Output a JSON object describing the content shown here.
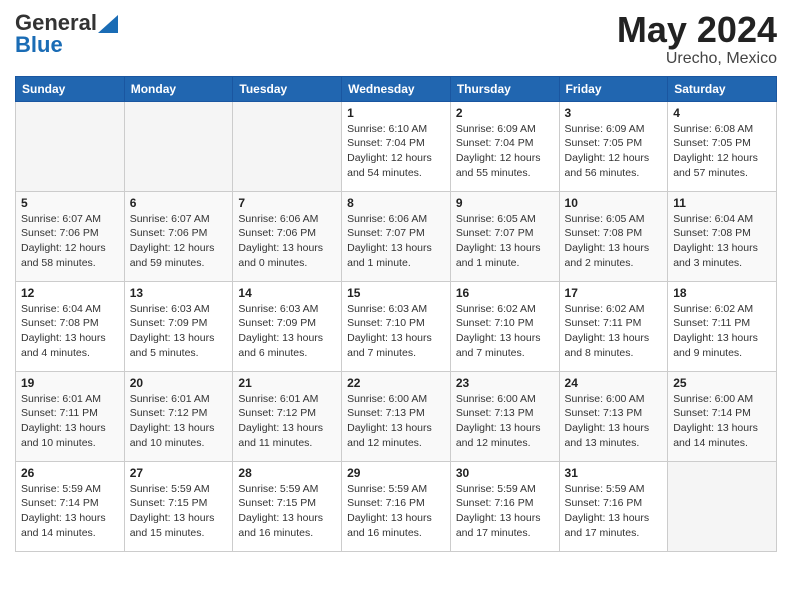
{
  "header": {
    "logo_general": "General",
    "logo_blue": "Blue",
    "month_year": "May 2024",
    "location": "Urecho, Mexico"
  },
  "days_of_week": [
    "Sunday",
    "Monday",
    "Tuesday",
    "Wednesday",
    "Thursday",
    "Friday",
    "Saturday"
  ],
  "weeks": [
    [
      {
        "day": "",
        "empty": true
      },
      {
        "day": "",
        "empty": true
      },
      {
        "day": "",
        "empty": true
      },
      {
        "day": "1",
        "sunrise": "6:10 AM",
        "sunset": "7:04 PM",
        "daylight": "12 hours and 54 minutes."
      },
      {
        "day": "2",
        "sunrise": "6:09 AM",
        "sunset": "7:04 PM",
        "daylight": "12 hours and 55 minutes."
      },
      {
        "day": "3",
        "sunrise": "6:09 AM",
        "sunset": "7:05 PM",
        "daylight": "12 hours and 56 minutes."
      },
      {
        "day": "4",
        "sunrise": "6:08 AM",
        "sunset": "7:05 PM",
        "daylight": "12 hours and 57 minutes."
      }
    ],
    [
      {
        "day": "5",
        "sunrise": "6:07 AM",
        "sunset": "7:06 PM",
        "daylight": "12 hours and 58 minutes."
      },
      {
        "day": "6",
        "sunrise": "6:07 AM",
        "sunset": "7:06 PM",
        "daylight": "12 hours and 59 minutes."
      },
      {
        "day": "7",
        "sunrise": "6:06 AM",
        "sunset": "7:06 PM",
        "daylight": "13 hours and 0 minutes."
      },
      {
        "day": "8",
        "sunrise": "6:06 AM",
        "sunset": "7:07 PM",
        "daylight": "13 hours and 1 minute."
      },
      {
        "day": "9",
        "sunrise": "6:05 AM",
        "sunset": "7:07 PM",
        "daylight": "13 hours and 1 minute."
      },
      {
        "day": "10",
        "sunrise": "6:05 AM",
        "sunset": "7:08 PM",
        "daylight": "13 hours and 2 minutes."
      },
      {
        "day": "11",
        "sunrise": "6:04 AM",
        "sunset": "7:08 PM",
        "daylight": "13 hours and 3 minutes."
      }
    ],
    [
      {
        "day": "12",
        "sunrise": "6:04 AM",
        "sunset": "7:08 PM",
        "daylight": "13 hours and 4 minutes."
      },
      {
        "day": "13",
        "sunrise": "6:03 AM",
        "sunset": "7:09 PM",
        "daylight": "13 hours and 5 minutes."
      },
      {
        "day": "14",
        "sunrise": "6:03 AM",
        "sunset": "7:09 PM",
        "daylight": "13 hours and 6 minutes."
      },
      {
        "day": "15",
        "sunrise": "6:03 AM",
        "sunset": "7:10 PM",
        "daylight": "13 hours and 7 minutes."
      },
      {
        "day": "16",
        "sunrise": "6:02 AM",
        "sunset": "7:10 PM",
        "daylight": "13 hours and 7 minutes."
      },
      {
        "day": "17",
        "sunrise": "6:02 AM",
        "sunset": "7:11 PM",
        "daylight": "13 hours and 8 minutes."
      },
      {
        "day": "18",
        "sunrise": "6:02 AM",
        "sunset": "7:11 PM",
        "daylight": "13 hours and 9 minutes."
      }
    ],
    [
      {
        "day": "19",
        "sunrise": "6:01 AM",
        "sunset": "7:11 PM",
        "daylight": "13 hours and 10 minutes."
      },
      {
        "day": "20",
        "sunrise": "6:01 AM",
        "sunset": "7:12 PM",
        "daylight": "13 hours and 10 minutes."
      },
      {
        "day": "21",
        "sunrise": "6:01 AM",
        "sunset": "7:12 PM",
        "daylight": "13 hours and 11 minutes."
      },
      {
        "day": "22",
        "sunrise": "6:00 AM",
        "sunset": "7:13 PM",
        "daylight": "13 hours and 12 minutes."
      },
      {
        "day": "23",
        "sunrise": "6:00 AM",
        "sunset": "7:13 PM",
        "daylight": "13 hours and 12 minutes."
      },
      {
        "day": "24",
        "sunrise": "6:00 AM",
        "sunset": "7:13 PM",
        "daylight": "13 hours and 13 minutes."
      },
      {
        "day": "25",
        "sunrise": "6:00 AM",
        "sunset": "7:14 PM",
        "daylight": "13 hours and 14 minutes."
      }
    ],
    [
      {
        "day": "26",
        "sunrise": "5:59 AM",
        "sunset": "7:14 PM",
        "daylight": "13 hours and 14 minutes."
      },
      {
        "day": "27",
        "sunrise": "5:59 AM",
        "sunset": "7:15 PM",
        "daylight": "13 hours and 15 minutes."
      },
      {
        "day": "28",
        "sunrise": "5:59 AM",
        "sunset": "7:15 PM",
        "daylight": "13 hours and 16 minutes."
      },
      {
        "day": "29",
        "sunrise": "5:59 AM",
        "sunset": "7:16 PM",
        "daylight": "13 hours and 16 minutes."
      },
      {
        "day": "30",
        "sunrise": "5:59 AM",
        "sunset": "7:16 PM",
        "daylight": "13 hours and 17 minutes."
      },
      {
        "day": "31",
        "sunrise": "5:59 AM",
        "sunset": "7:16 PM",
        "daylight": "13 hours and 17 minutes."
      },
      {
        "day": "",
        "empty": true
      }
    ]
  ],
  "labels": {
    "sunrise": "Sunrise:",
    "sunset": "Sunset:",
    "daylight": "Daylight:"
  }
}
